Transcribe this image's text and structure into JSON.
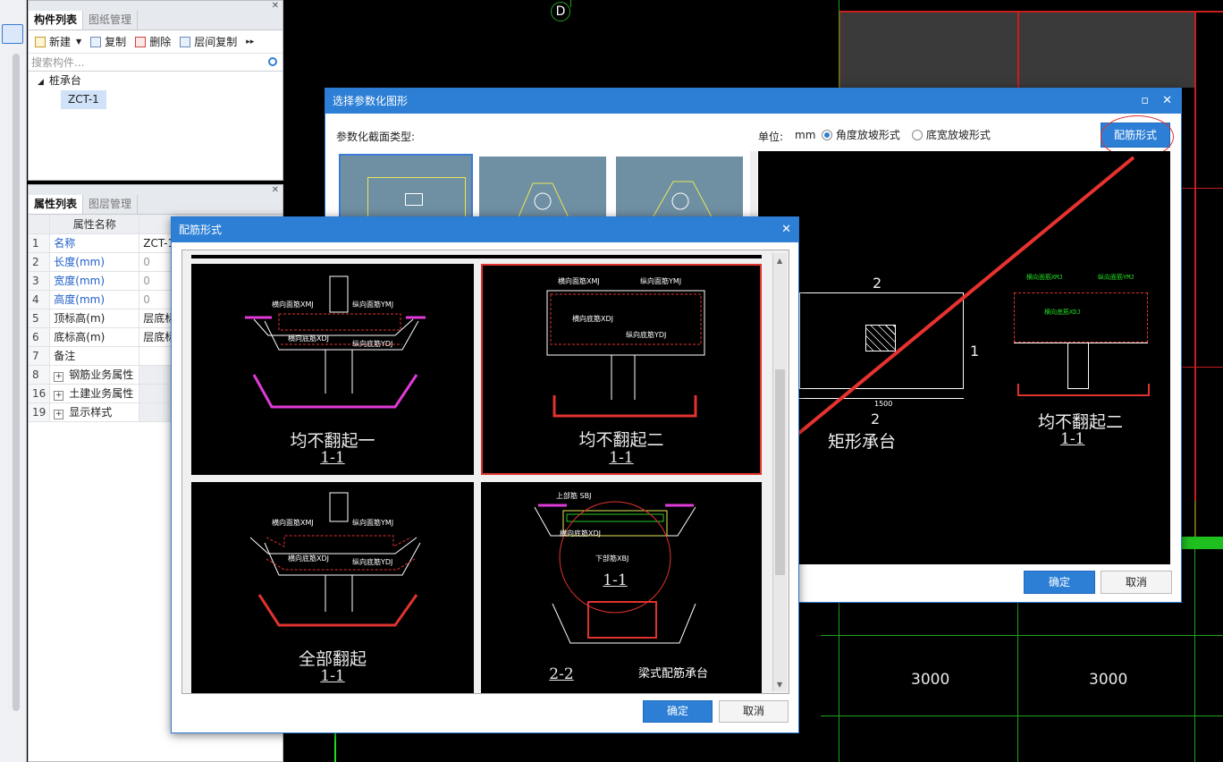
{
  "left_tabs": {
    "components": "构件列表",
    "drawings": "图纸管理"
  },
  "toolbar": {
    "new": "新建",
    "copy": "复制",
    "delete": "删除",
    "floor_copy": "层间复制"
  },
  "search": {
    "placeholder": "搜索构件..."
  },
  "tree": {
    "root": "桩承台",
    "child": "ZCT-1"
  },
  "prop_tabs": {
    "properties": "属性列表",
    "layers": "图层管理"
  },
  "prop_header": {
    "name": "属性名称"
  },
  "props": [
    {
      "num": "1",
      "name": "名称",
      "value": "ZCT-1"
    },
    {
      "num": "2",
      "name": "长度(mm)",
      "value": "0"
    },
    {
      "num": "3",
      "name": "宽度(mm)",
      "value": "0"
    },
    {
      "num": "4",
      "name": "高度(mm)",
      "value": "0"
    },
    {
      "num": "5",
      "name": "顶标高(m)",
      "value": "层底标"
    },
    {
      "num": "6",
      "name": "底标高(m)",
      "value": "层底标"
    },
    {
      "num": "7",
      "name": "备注",
      "value": ""
    },
    {
      "num": "8",
      "name": "钢筋业务属性",
      "value": ""
    },
    {
      "num": "16",
      "name": "土建业务属性",
      "value": ""
    },
    {
      "num": "19",
      "name": "显示样式",
      "value": ""
    }
  ],
  "cad": {
    "axis": "D",
    "dim1": "3000",
    "dim2": "3000"
  },
  "param_dialog": {
    "title": "选择参数化图形",
    "section_type_label": "参数化截面类型:",
    "unit_label": "单位:",
    "unit": "mm",
    "radio1": "角度放坡形式",
    "radio2": "底宽放坡形式",
    "rebar_button": "配筋形式",
    "ok": "确定",
    "cancel": "取消",
    "preview": {
      "label2": "2",
      "label1": "1",
      "dim1500": "1500",
      "label2b": "2",
      "shape_name": "矩形承台",
      "rebar_name": "均不翻起二",
      "section": "1-1"
    }
  },
  "rebar_dialog": {
    "title": "配筋形式",
    "ok": "确定",
    "cancel": "取消",
    "options": [
      {
        "caption": "均不翻起一",
        "section": "1-1"
      },
      {
        "caption": "均不翻起二",
        "section": "1-1"
      },
      {
        "caption": "全部翻起",
        "section": "1-1"
      },
      {
        "caption": "梁式配筋承台",
        "section": "1-1",
        "section2": "2-2"
      }
    ],
    "notes": {
      "xmj": "横向面筋XMJ",
      "ymj": "纵向面筋YMJ",
      "xdj": "横向底筋XDJ",
      "ydj": "纵向底筋YDJ",
      "sbj": "上部筋 SBJ",
      "xbj": "下部筋XBJ"
    }
  },
  "colors": {
    "accent": "#2d7fd6",
    "highlight": "#e0332f",
    "cad_green": "#1fa31f"
  }
}
